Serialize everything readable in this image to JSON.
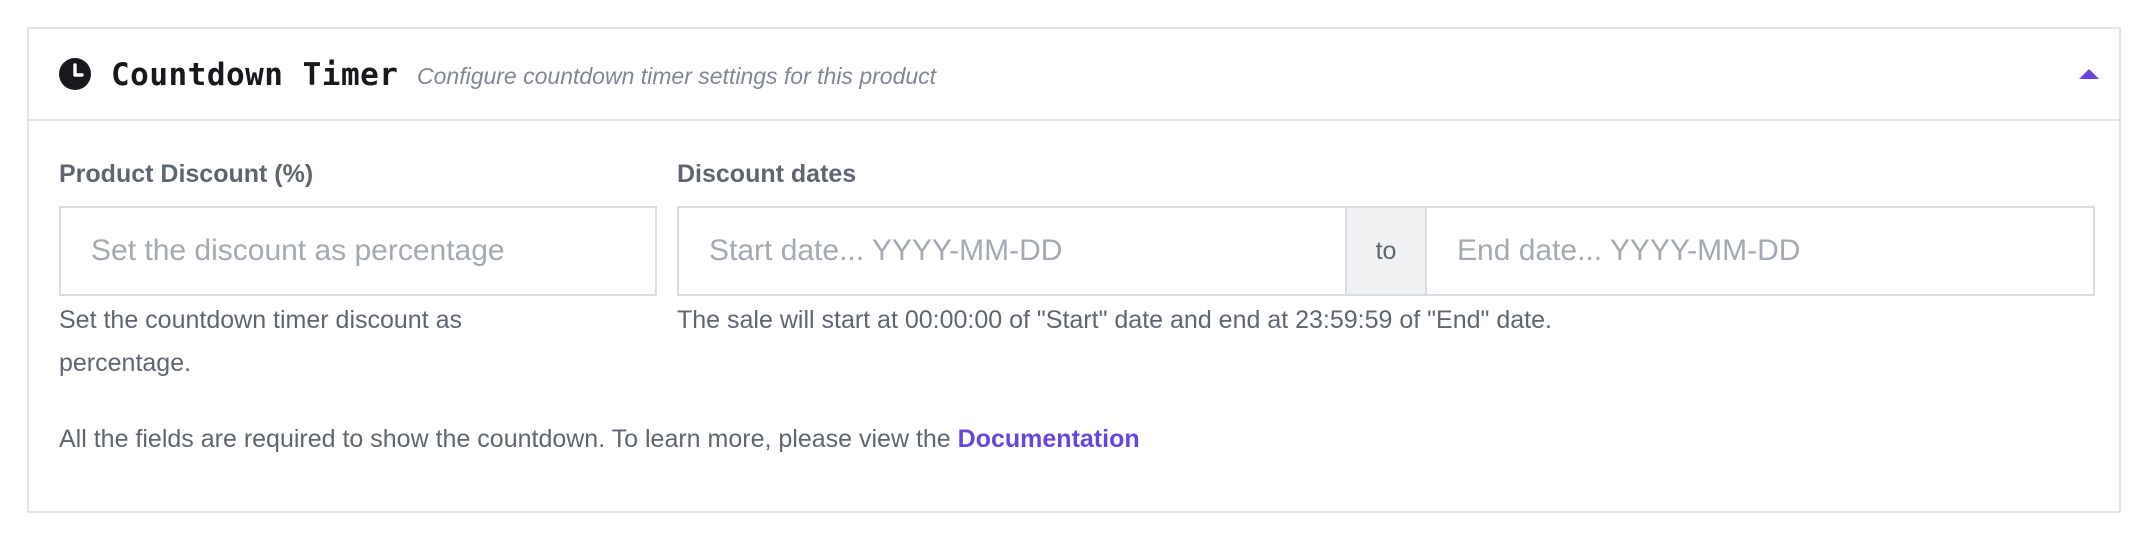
{
  "header": {
    "icon": "clock-icon",
    "title": "Countdown Timer",
    "subtitle": "Configure countdown timer settings for this product",
    "toggle_icon": "chevron-up-icon"
  },
  "discount": {
    "label": "Product Discount (%)",
    "value": "",
    "placeholder": "Set the discount as percentage",
    "help": "Set the countdown timer discount as percentage."
  },
  "dates": {
    "label": "Discount dates",
    "start": {
      "value": "",
      "placeholder": "Start date... YYYY-MM-DD"
    },
    "separator": "to",
    "end": {
      "value": "",
      "placeholder": "End date... YYYY-MM-DD"
    },
    "help": "The sale will start at 00:00:00 of \"Start\" date and end at 23:59:59 of \"End\" date."
  },
  "footer": {
    "note": "All the fields are required to show the countdown. To learn more, please view the",
    "link_label": "Documentation"
  },
  "colors": {
    "accent": "#6a44de",
    "text": "#5f6670",
    "title": "#17191c",
    "border": "#e3e5e8"
  }
}
